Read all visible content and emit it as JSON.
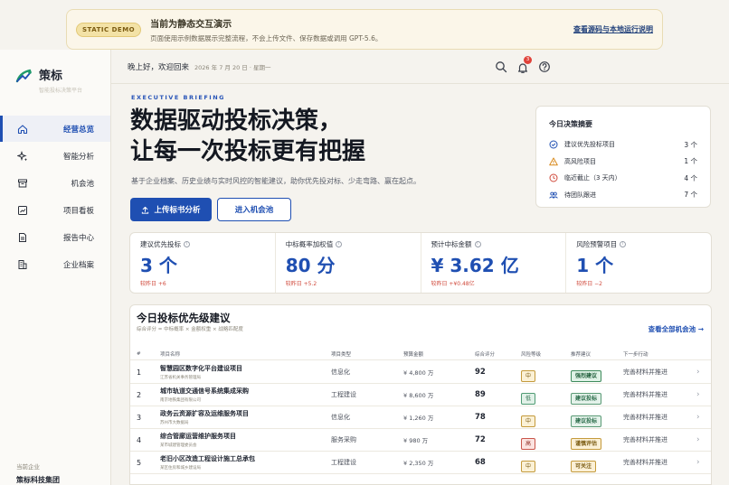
{
  "demo_banner": {
    "badge": "STATIC DEMO",
    "title": "当前为静态交互演示",
    "description": "页面使用示例数据展示完整流程，不会上传文件、保存数据或调用 GPT-5.6。",
    "link": "查看源码与本地运行说明"
  },
  "sidebar": {
    "app_name": "策标",
    "app_tagline": "智能投标决策平台",
    "items": [
      {
        "label": "经营总览",
        "icon": "home-icon",
        "active": true
      },
      {
        "label": "智能分析",
        "icon": "sparkle-icon",
        "active": false
      },
      {
        "label": "机会池",
        "icon": "archive-icon",
        "active": false
      },
      {
        "label": "项目看板",
        "icon": "chart-icon",
        "active": false
      },
      {
        "label": "报告中心",
        "icon": "document-icon",
        "active": false
      },
      {
        "label": "企业档案",
        "icon": "building-icon",
        "active": false
      }
    ],
    "company_label": "当前企业",
    "company_name": "策标科技集团"
  },
  "topbar": {
    "greeting": "晚上好，欢迎回来",
    "date": "2026 年 7 月 20 日 · 星期一",
    "notification_count": "3"
  },
  "hero": {
    "eyebrow": "EXECUTIVE BRIEFING",
    "title_line1": "数据驱动投标决策，",
    "title_line2": "让每一次投标更有把握",
    "subtitle": "基于企业档案、历史业绩与实时风控的智能建议，助你优先投对标、少走弯路、赢在起点。",
    "primary_button": "上传标书分析",
    "secondary_button": "进入机会池"
  },
  "summary": {
    "title": "今日决策摘要",
    "rows": [
      {
        "label": "建议优先投标项目",
        "value": "3 个",
        "icon": "check-circle-icon",
        "color": "#1f4fb2"
      },
      {
        "label": "高风险项目",
        "value": "1 个",
        "icon": "warning-icon",
        "color": "#d98b1f"
      },
      {
        "label": "临近截止（3 天内）",
        "value": "4 个",
        "icon": "clock-icon",
        "color": "#d04a3c"
      },
      {
        "label": "待团队跟进",
        "value": "7 个",
        "icon": "team-icon",
        "color": "#1f4fb2"
      }
    ]
  },
  "kpis": [
    {
      "label": "建议优先投标",
      "value": "3 个",
      "delta": "较昨日 +6"
    },
    {
      "label": "中标概率加权值",
      "value": "80 分",
      "delta": "较昨日 +5.2"
    },
    {
      "label": "预计中标金额",
      "value": "¥ 3.62 亿",
      "delta": "较昨日 +¥0.48亿"
    },
    {
      "label": "风险预警项目",
      "value": "1 个",
      "delta": "较昨日 −2"
    }
  ],
  "priority_table": {
    "title": "今日投标优先级建议",
    "subtitle": "综合评分 = 中标概率 × 金额权重 × 战略匹配度",
    "link": "查看全部机会池 →",
    "headers": [
      "#",
      "项目名称",
      "项目类型",
      "预算金额",
      "综合评分",
      "风险等级",
      "推荐建议",
      "下一步行动"
    ],
    "rows": [
      {
        "no": "1",
        "name": "智慧园区数字化平台建设项目",
        "org": "江苏省机关事务管理局",
        "type": "信息化",
        "amount": "¥ 4,800 万",
        "score": "92",
        "risk": "中",
        "risk_level": "mid",
        "rec": "强烈建议",
        "rec_level": "strong",
        "next": "完善材料并推进"
      },
      {
        "no": "2",
        "name": "城市轨道交通信号系统集成采购",
        "org": "南京地铁集团有限公司",
        "type": "工程建设",
        "amount": "¥ 8,600 万",
        "score": "89",
        "risk": "低",
        "risk_level": "low",
        "rec": "建议投标",
        "rec_level": "ok",
        "next": "完善材料并推进"
      },
      {
        "no": "3",
        "name": "政务云资源扩容及运维服务项目",
        "org": "苏州市大数据局",
        "type": "信息化",
        "amount": "¥ 1,260 万",
        "score": "78",
        "risk": "中",
        "risk_level": "mid",
        "rec": "建议投标",
        "rec_level": "ok",
        "next": "完善材料并推进"
      },
      {
        "no": "4",
        "name": "综合管廊运营维护服务项目",
        "org": "某市城建管理委员会",
        "type": "服务采购",
        "amount": "¥ 980 万",
        "score": "72",
        "risk": "高",
        "risk_level": "high",
        "rec": "谨慎评估",
        "rec_level": "care",
        "next": "完善材料并推进"
      },
      {
        "no": "5",
        "name": "老旧小区改造工程设计施工总承包",
        "org": "某区住房和城乡建设局",
        "type": "工程建设",
        "amount": "¥ 2,350 万",
        "score": "68",
        "risk": "中",
        "risk_level": "mid",
        "rec": "可关注",
        "rec_level": "maybe",
        "next": "完善材料并推进"
      }
    ]
  }
}
